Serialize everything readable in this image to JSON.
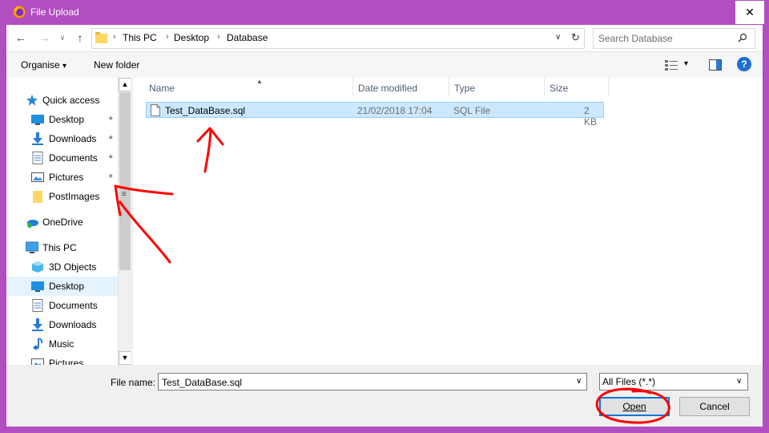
{
  "window": {
    "title": "File Upload",
    "close_glyph": "✕"
  },
  "nav": {
    "back_glyph": "←",
    "forward_glyph": "→",
    "dropdown_glyph": "∨",
    "up_glyph": "↑",
    "breadcrumb": [
      "This PC",
      "Desktop",
      "Database"
    ],
    "crumb_sep": "›",
    "refresh_glyph": "↻",
    "search_placeholder": "Search Database"
  },
  "toolbar": {
    "organise": "Organise",
    "organise_caret": "▾",
    "new_folder": "New folder",
    "view_caret": "▾",
    "help_glyph": "?"
  },
  "navpane": {
    "items": [
      {
        "label": "Quick access",
        "icon": "star-icon",
        "pinned": false
      },
      {
        "label": "Desktop",
        "icon": "desktop-icon",
        "pinned": true
      },
      {
        "label": "Downloads",
        "icon": "download-icon",
        "pinned": true
      },
      {
        "label": "Documents",
        "icon": "documents-icon",
        "pinned": true
      },
      {
        "label": "Pictures",
        "icon": "pictures-icon",
        "pinned": true
      },
      {
        "label": "PostImages",
        "icon": "folder-icon",
        "pinned": false
      },
      {
        "label": "OneDrive",
        "icon": "onedrive-icon",
        "pinned": false
      },
      {
        "label": "This PC",
        "icon": "this-pc-icon",
        "pinned": false
      },
      {
        "label": "3D Objects",
        "icon": "3d-objects-icon",
        "pinned": false
      },
      {
        "label": "Desktop",
        "icon": "desktop-icon",
        "pinned": false,
        "selected": true
      },
      {
        "label": "Documents",
        "icon": "documents-icon",
        "pinned": false
      },
      {
        "label": "Downloads",
        "icon": "download-icon",
        "pinned": false
      },
      {
        "label": "Music",
        "icon": "music-icon",
        "pinned": false
      },
      {
        "label": "Pictures",
        "icon": "pictures-icon",
        "pinned": false
      }
    ],
    "pin_glyph": "📌",
    "scroll_up": "▲",
    "scroll_down": "▼",
    "scroll_grip": "≡"
  },
  "filelist": {
    "columns": {
      "name": "Name",
      "date": "Date modified",
      "type": "Type",
      "size": "Size"
    },
    "sort_arrow": "▲",
    "rows": [
      {
        "name": "Test_DataBase.sql",
        "date": "21/02/2018 17:04",
        "type": "SQL File",
        "size": "2 KB",
        "selected": true
      }
    ]
  },
  "bottom": {
    "filename_label": "File name:",
    "filename_value": "Test_DataBase.sql",
    "dd_glyph": "∨",
    "filetype_value": "All Files (*.*)",
    "open_label": "Open",
    "cancel_label": "Cancel"
  },
  "colors": {
    "frame": "#b14ec0",
    "selection": "#cce8ff",
    "annotation": "#ff0000",
    "accent": "#0078d7"
  }
}
